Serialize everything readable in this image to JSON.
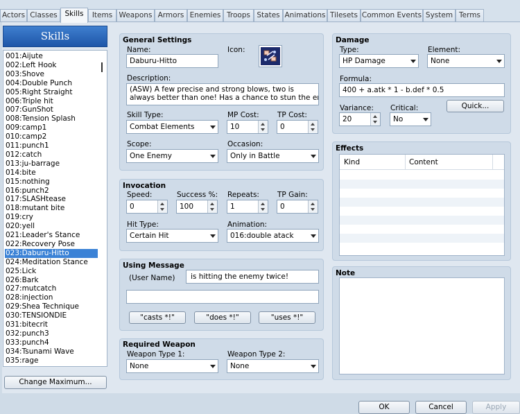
{
  "tabs": [
    "Actors",
    "Classes",
    "Skills",
    "Items",
    "Weapons",
    "Armors",
    "Enemies",
    "Troops",
    "States",
    "Animations",
    "Tilesets",
    "Common Events",
    "System",
    "Terms"
  ],
  "list": {
    "header": "Skills",
    "items": [
      "001:Aijute",
      "002:Left Hook",
      "003:Shove",
      "004:Double Punch",
      "005:Right Straight",
      "006:Triple hit",
      "007:GunShot",
      "008:Tension Splash",
      "009:camp1",
      "010:camp2",
      "011:punch1",
      "012:catch",
      "013:ju-barrage",
      "014:bite",
      "015:nothing",
      "016:punch2",
      "017:SLASHtease",
      "018:mutant bite",
      "019:cry",
      "020:yell",
      "021:Leader's Stance",
      "022:Recovery Pose",
      "023:Daburu-Hitto",
      "024:Meditation Stance",
      "025:Lick",
      "026:Bark",
      "027:mutcatch",
      "028:injection",
      "029:Shea Technique",
      "030:TENSIONDIE",
      "031:bitecrit",
      "032:punch3",
      "033:punch4",
      "034:Tsunami Wave",
      "035:rage"
    ],
    "selected_index": 22,
    "change_max": "Change Maximum..."
  },
  "general": {
    "title": "General Settings",
    "name_label": "Name:",
    "name": "Daburu-Hitto",
    "icon_label": "Icon:",
    "desc_label": "Description:",
    "desc_line1": "(ASW) A few precise and strong blows, two is",
    "desc_line2": "always better than one! Has a chance to stun the ener",
    "skilltype_label": "Skill Type:",
    "skilltype": "Combat Elements",
    "mp_label": "MP Cost:",
    "mp": "10",
    "tp_label": "TP Cost:",
    "tp": "0",
    "scope_label": "Scope:",
    "scope": "One Enemy",
    "occasion_label": "Occasion:",
    "occasion": "Only in Battle"
  },
  "invocation": {
    "title": "Invocation",
    "speed_label": "Speed:",
    "speed": "0",
    "success_label": "Success %:",
    "success": "100",
    "repeats_label": "Repeats:",
    "repeats": "1",
    "tpgain_label": "TP Gain:",
    "tpgain": "0",
    "hittype_label": "Hit Type:",
    "hittype": "Certain Hit",
    "anim_label": "Animation:",
    "anim": "016:double atack"
  },
  "message": {
    "title": "Using Message",
    "user_label": "(User Name)",
    "line1": "is hitting the enemy twice!",
    "line2": "",
    "btn_casts": "\"casts *!\"",
    "btn_does": "\"does *!\"",
    "btn_uses": "\"uses *!\""
  },
  "weapon": {
    "title": "Required Weapon",
    "wt1_label": "Weapon Type 1:",
    "wt1": "None",
    "wt2_label": "Weapon Type 2:",
    "wt2": "None"
  },
  "damage": {
    "title": "Damage",
    "type_label": "Type:",
    "type": "HP Damage",
    "element_label": "Element:",
    "element": "None",
    "formula_label": "Formula:",
    "formula": "400 + a.atk * 1 - b.def * 0.5",
    "variance_label": "Variance:",
    "variance": "20",
    "critical_label": "Critical:",
    "critical": "No",
    "quick": "Quick..."
  },
  "effects": {
    "title": "Effects",
    "col_kind": "Kind",
    "col_content": "Content"
  },
  "note": {
    "title": "Note"
  },
  "footer": {
    "ok": "OK",
    "cancel": "Cancel",
    "apply": "Apply"
  }
}
